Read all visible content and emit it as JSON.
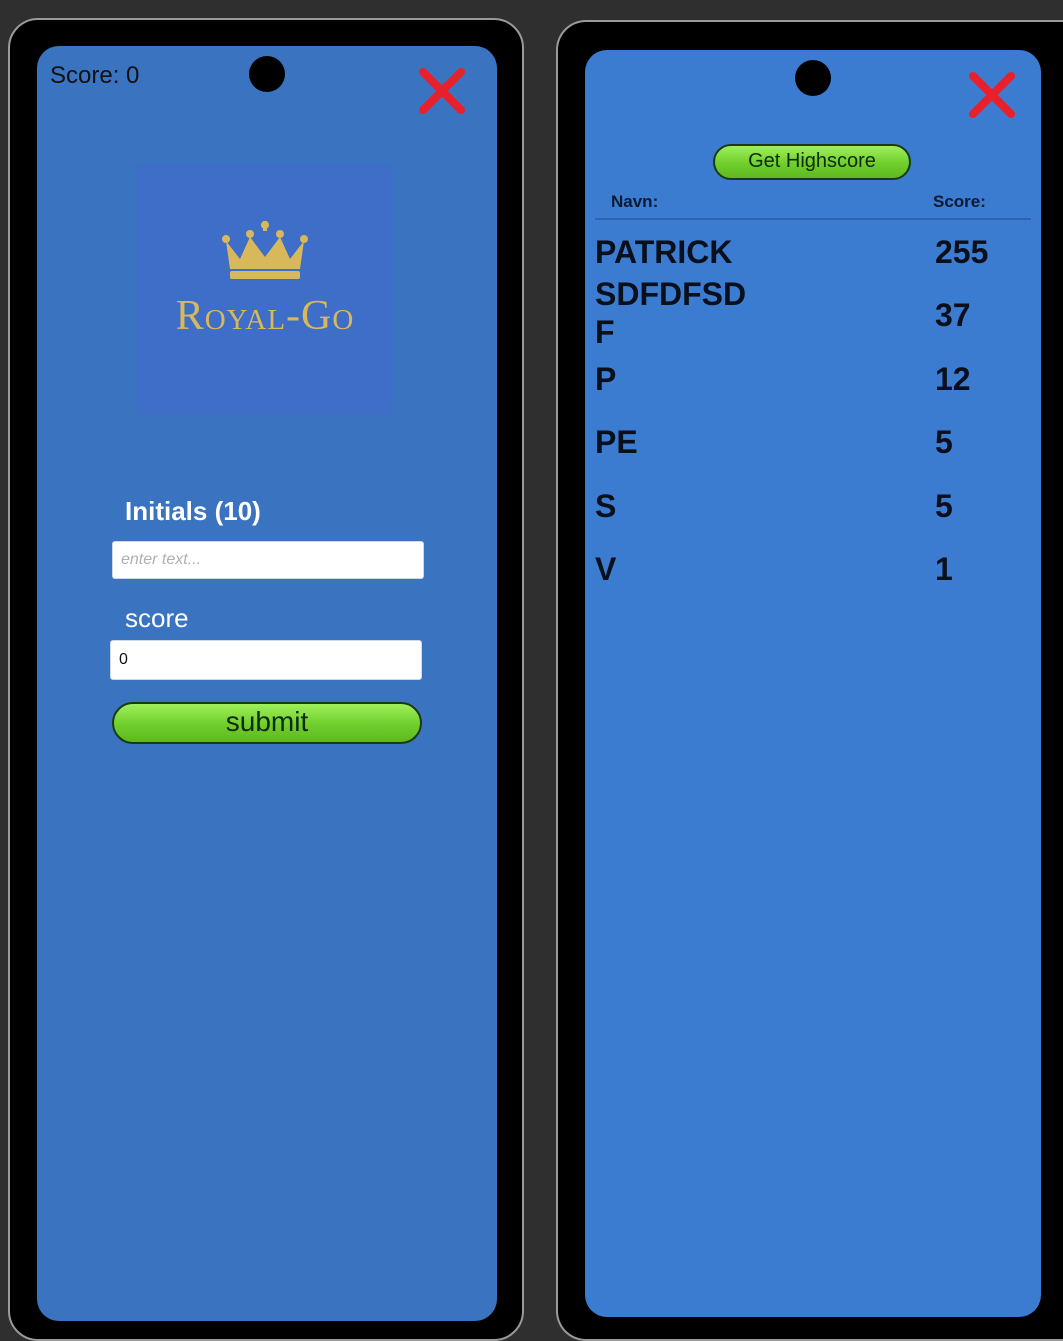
{
  "left_screen": {
    "score_text": "Score: 0",
    "logo_text": "Royal-Go",
    "initials_label": "Initials (10)",
    "initials_placeholder": "enter text...",
    "score_label": "score",
    "score_value": "0",
    "submit_label": "submit"
  },
  "right_screen": {
    "button_label": "Get Highscore",
    "columns": {
      "name": "Navn:",
      "score": "Score:"
    },
    "rows": [
      {
        "name": "PATRICK",
        "score": "255"
      },
      {
        "name": "SDFDFSD\nF",
        "score": "37"
      },
      {
        "name": "P",
        "score": "12"
      },
      {
        "name": "PE",
        "score": "5"
      },
      {
        "name": "S",
        "score": "5"
      },
      {
        "name": "V",
        "score": "1"
      }
    ]
  },
  "icons": {
    "close": "close-x-icon",
    "crown": "crown-icon",
    "camera": "camera-notch-icon"
  },
  "colors": {
    "screen_left": "#3a73c0",
    "screen_right": "#3b7bd0",
    "accent_green": "#7ad836",
    "close_red": "#e8202c",
    "logo_gold": "#d9b85c"
  }
}
